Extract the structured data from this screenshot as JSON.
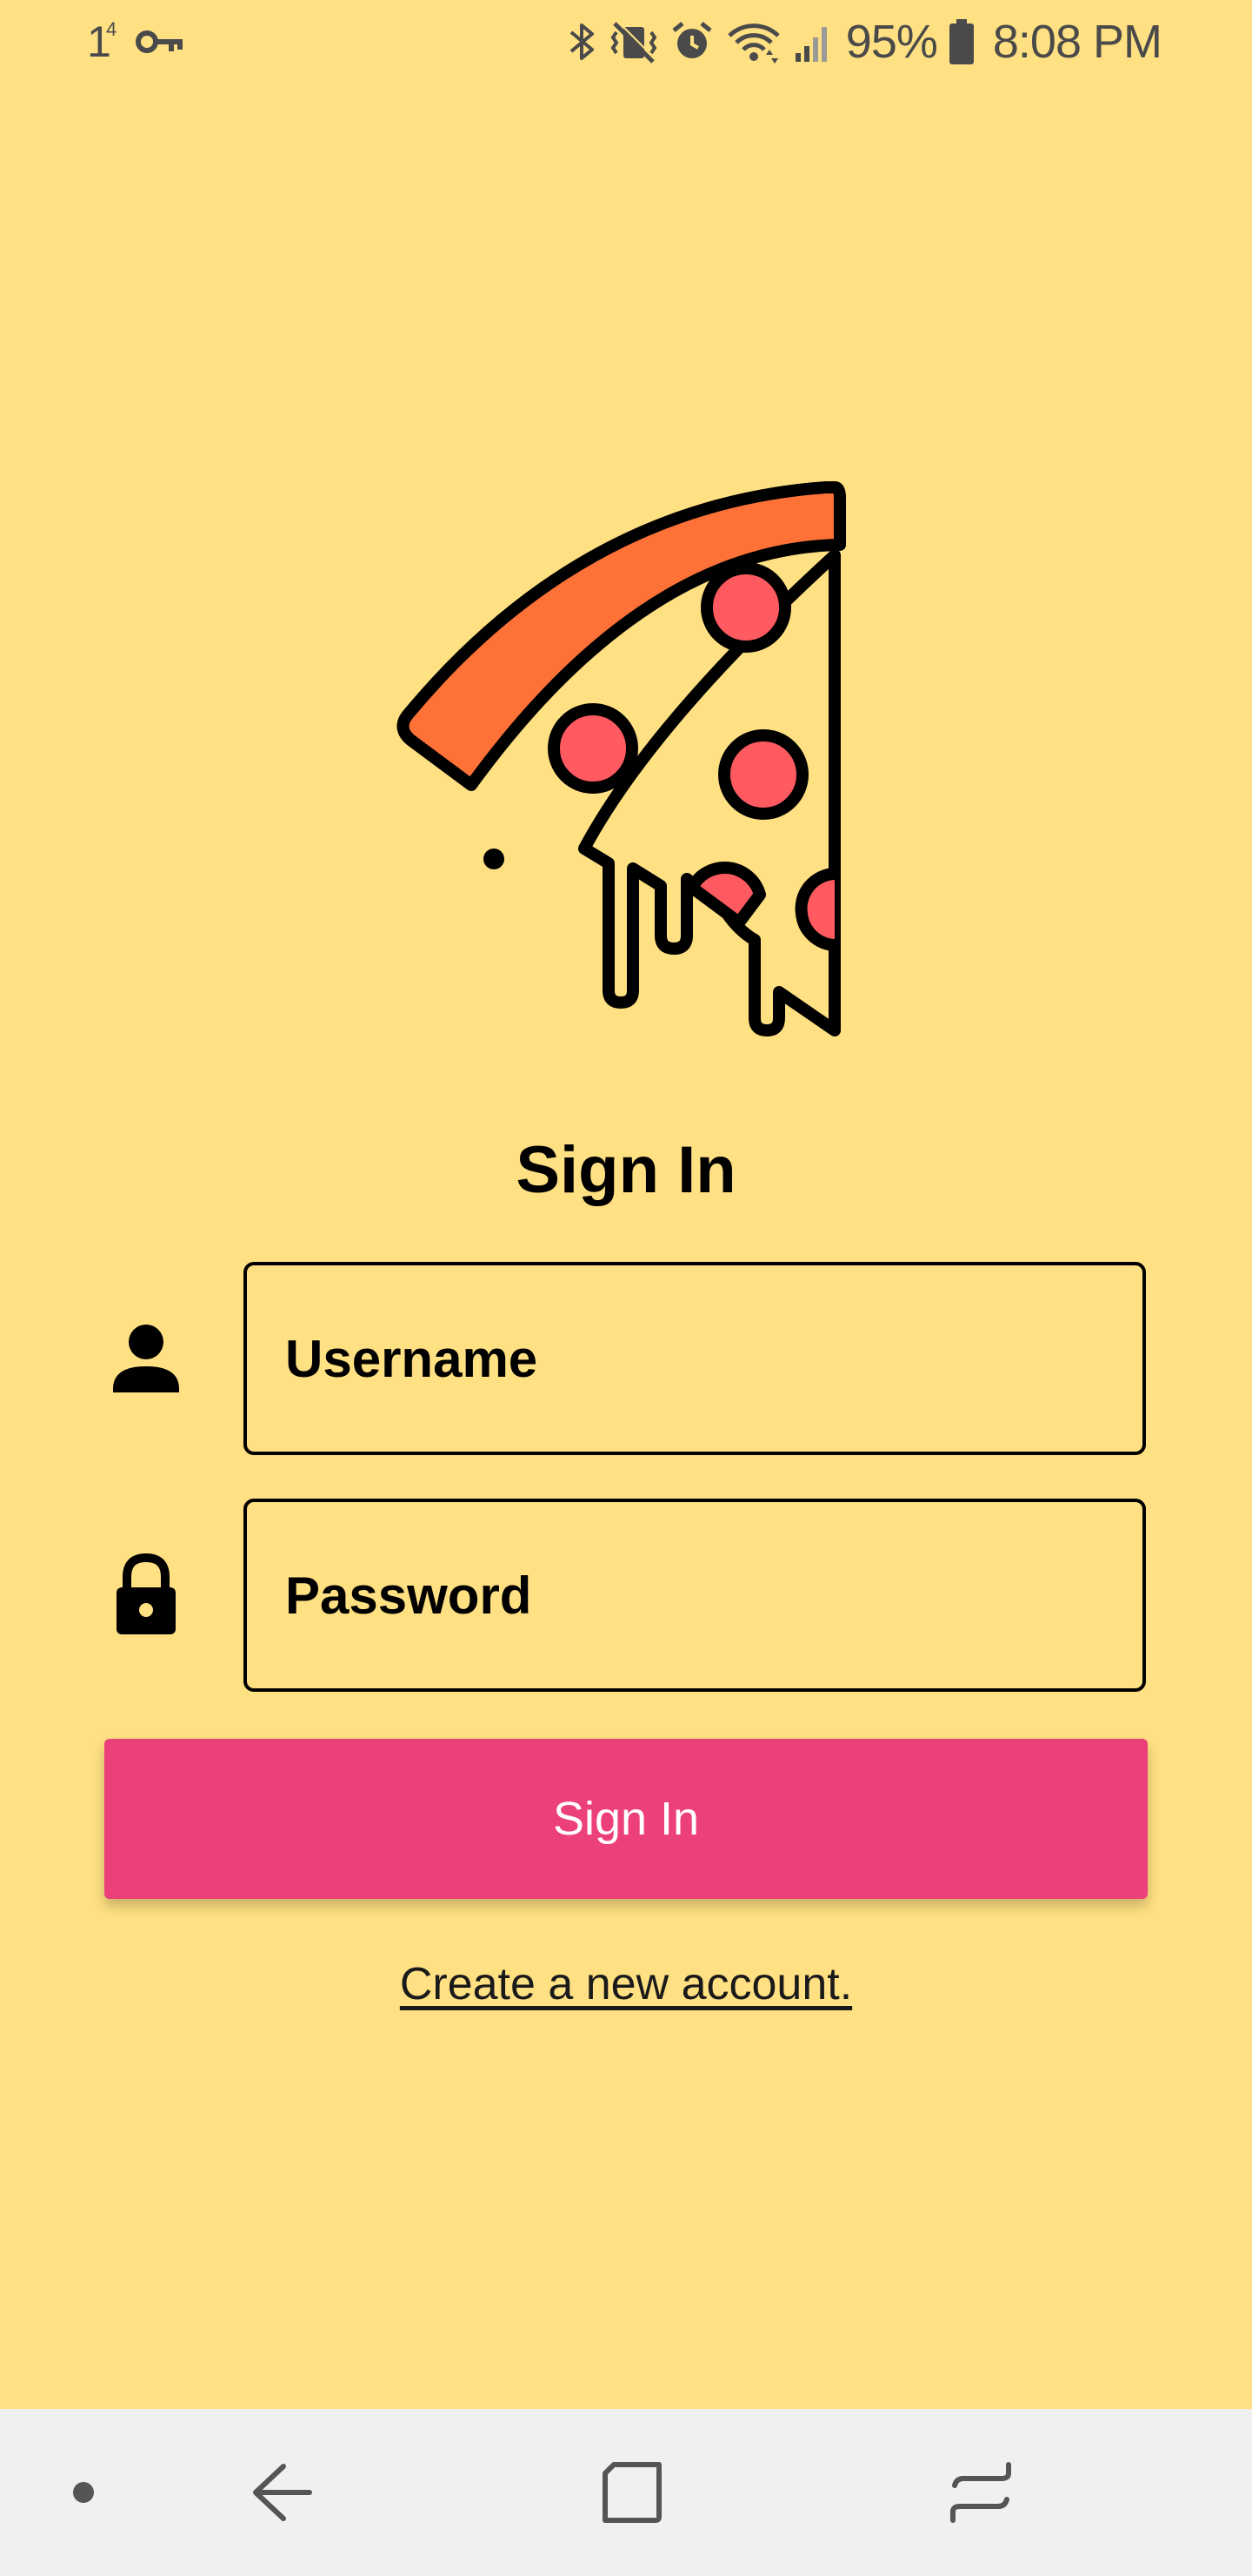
{
  "status_bar": {
    "notification_count": "1",
    "notification_superscript": "4",
    "battery": "95%",
    "time": "8:08 PM",
    "icons": [
      "key-icon",
      "bluetooth-icon",
      "vibrate-mute-icon",
      "alarm-icon",
      "wifi-icon",
      "signal-icon",
      "battery-icon"
    ]
  },
  "logo": {
    "icon": "pizza-slice-icon",
    "colors": {
      "crust": "#FF7237",
      "pepperoni": "#FF5A5F",
      "cheese": "#FFE082",
      "outline": "#000000"
    }
  },
  "form": {
    "title": "Sign In",
    "username": {
      "icon": "person-icon",
      "placeholder": "Username",
      "value": ""
    },
    "password": {
      "icon": "lock-icon",
      "placeholder": "Password",
      "value": ""
    },
    "submit_label": "Sign In",
    "create_account_label": "Create a new account."
  },
  "theme": {
    "background": "#FFE082",
    "accent": "#EC407A",
    "nav_background": "#F0F0F0"
  },
  "nav_bar": {
    "buttons": [
      "dot-icon",
      "back-icon",
      "home-icon",
      "recents-icon"
    ]
  }
}
